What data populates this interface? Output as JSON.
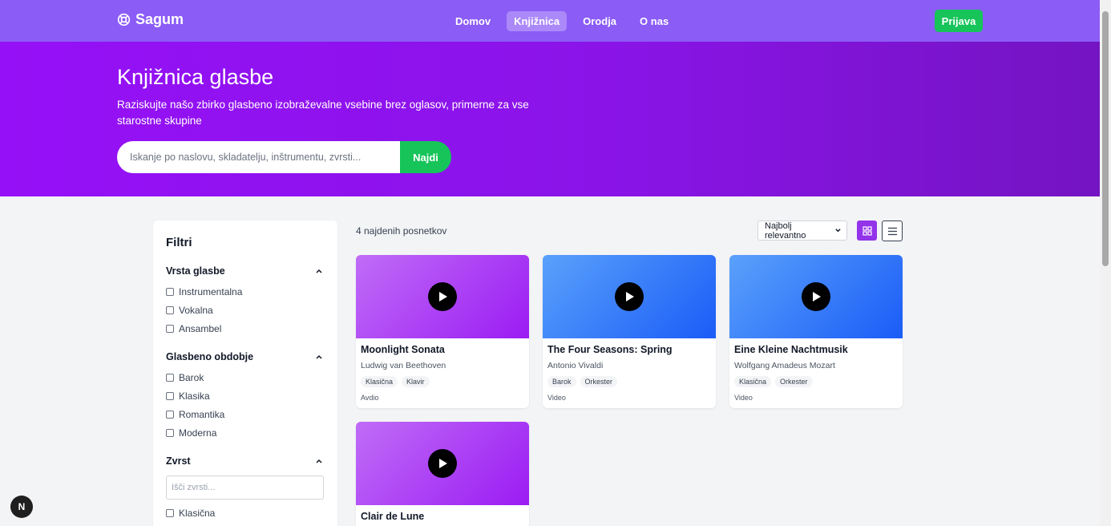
{
  "nav": {
    "brand": "Sagum",
    "links": [
      {
        "label": "Domov",
        "active": false
      },
      {
        "label": "Knjižnica",
        "active": true
      },
      {
        "label": "Orodja",
        "active": false
      },
      {
        "label": "O nas",
        "active": false
      }
    ],
    "login_label": "Prijava"
  },
  "hero": {
    "title": "Knjižnica glasbe",
    "subtitle": "Raziskujte našo zbirko glasbeno izobraževalne vsebine brez oglasov, primerne za vse starostne skupine",
    "search_placeholder": "Iskanje po naslovu, skladatelju, inštrumentu, zvrsti...",
    "search_button": "Najdi"
  },
  "sidebar": {
    "title": "Filtri",
    "groups": [
      {
        "title": "Vrsta glasbe",
        "options": [
          "Instrumentalna",
          "Vokalna",
          "Ansambel"
        ]
      },
      {
        "title": "Glasbeno obdobje",
        "options": [
          "Barok",
          "Klasika",
          "Romantika",
          "Moderna"
        ]
      },
      {
        "title": "Zvrst",
        "search_placeholder": "Išči zvrsti...",
        "options": [
          "Klasična"
        ]
      }
    ]
  },
  "results": {
    "count_text": "4 najdenih posnetkov",
    "sort_label": "Najbolj relevantno"
  },
  "cards": [
    {
      "title": "Moonlight Sonata",
      "composer": "Ludwig van Beethoven",
      "tags": [
        "Klasična",
        "Klavir"
      ],
      "type": "Avdio",
      "color": "purple"
    },
    {
      "title": "The Four Seasons: Spring",
      "composer": "Antonio Vivaldi",
      "tags": [
        "Barok",
        "Orkester"
      ],
      "type": "Video",
      "color": "blue"
    },
    {
      "title": "Eine Kleine Nachtmusik",
      "composer": "Wolfgang Amadeus Mozart",
      "tags": [
        "Klasična",
        "Orkester"
      ],
      "type": "Video",
      "color": "blue"
    },
    {
      "title": "Clair de Lune",
      "composer": "",
      "tags": [],
      "type": "",
      "color": "purple"
    }
  ],
  "colors": {
    "nav_bg": "#8b5cf6",
    "accent_green": "#16c45a",
    "accent_purple": "#9333ea"
  },
  "icons": {
    "brand": "lifebuoy-icon",
    "play": "play-icon",
    "chevron": "chevron-up-icon",
    "grid_view": "grid-icon",
    "list_view": "list-icon",
    "next_badge": "N"
  }
}
